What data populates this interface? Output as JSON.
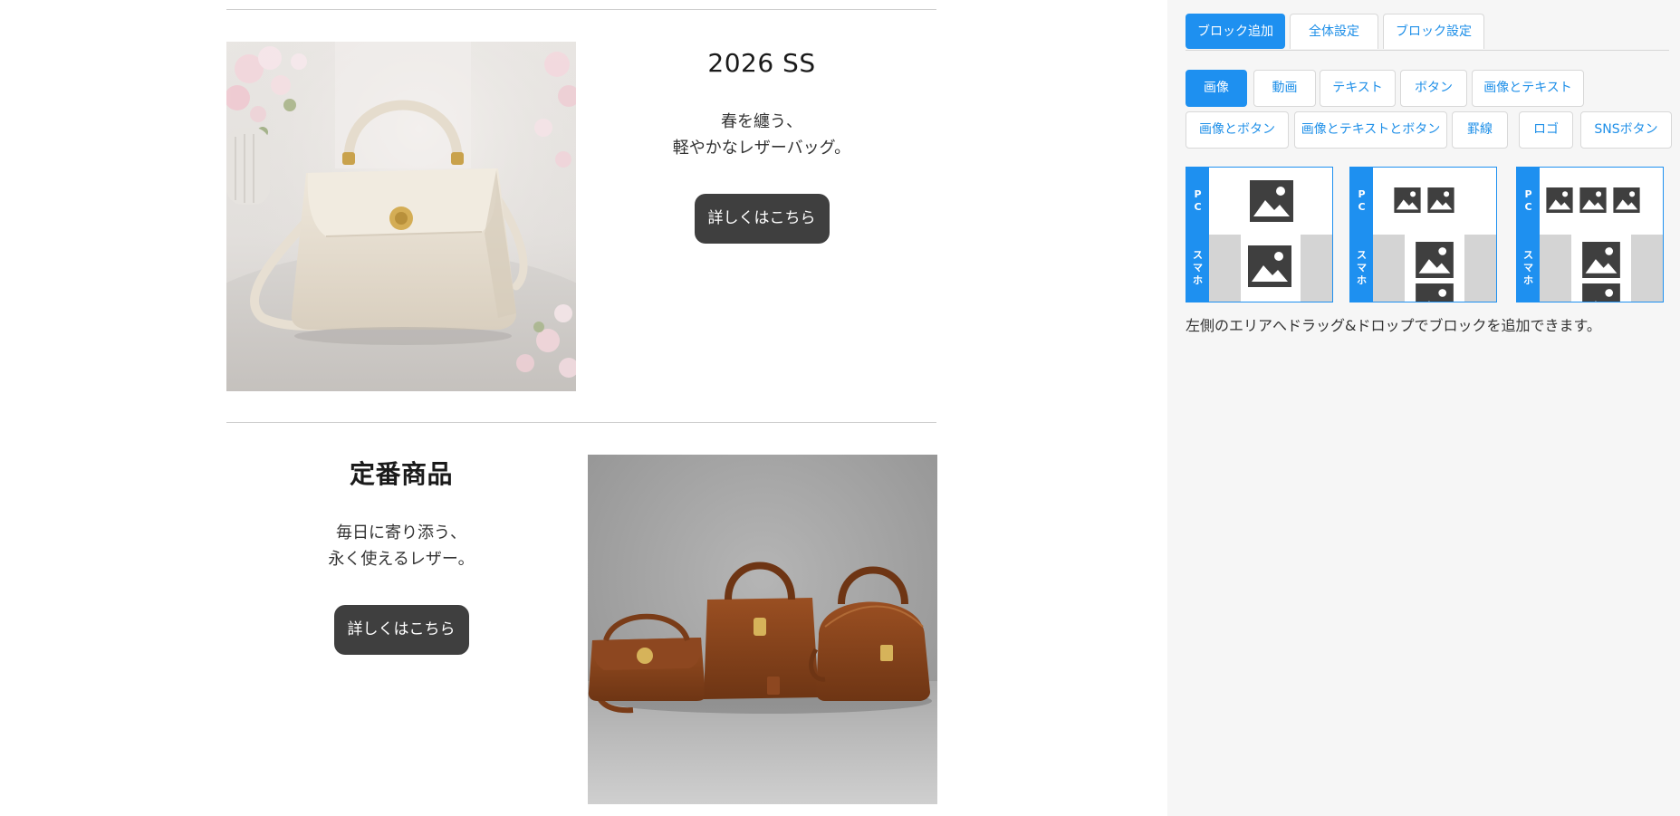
{
  "blocks": [
    {
      "title": "2026 SS",
      "copy_line1": "春を纏う、",
      "copy_line2": "軽やかなレザーバッグ。",
      "button_label": "詳しくはこちら"
    },
    {
      "title": "定番商品",
      "copy_line1": "毎日に寄り添う、",
      "copy_line2": "永く使えるレザー。",
      "button_label": "詳しくはこちら"
    }
  ],
  "panel": {
    "tabs": [
      {
        "label": "ブロック追加",
        "active": true
      },
      {
        "label": "全体設定",
        "active": false
      },
      {
        "label": "ブロック設定",
        "active": false
      }
    ],
    "categories": [
      {
        "label": "画像",
        "active": true
      },
      {
        "label": "動画",
        "active": false
      },
      {
        "label": "テキスト",
        "active": false
      },
      {
        "label": "ボタン",
        "active": false
      },
      {
        "label": "画像とテキスト",
        "active": false
      },
      {
        "label": "画像とボタン",
        "active": false
      },
      {
        "label": "画像とテキストとボタン",
        "active": false
      },
      {
        "label": "罫線",
        "active": false
      },
      {
        "label": "ロゴ",
        "active": false
      },
      {
        "label": "SNSボタン",
        "active": false
      }
    ],
    "templates": [
      {
        "pc_label": "PC",
        "sp_label": "スマホ",
        "image_count": 1
      },
      {
        "pc_label": "PC",
        "sp_label": "スマホ",
        "image_count": 2
      },
      {
        "pc_label": "PC",
        "sp_label": "スマホ",
        "image_count": 3
      }
    ],
    "help_text": "左側のエリアへドラッグ&ドロップでブロックを追加できます。"
  },
  "colors": {
    "accent": "#1e90f0",
    "button_dark": "#3f3f3f",
    "panel_bg": "#f6f6f6",
    "divider": "#cfcfcf"
  },
  "icons": {
    "template_image": "image-placeholder-icon"
  }
}
